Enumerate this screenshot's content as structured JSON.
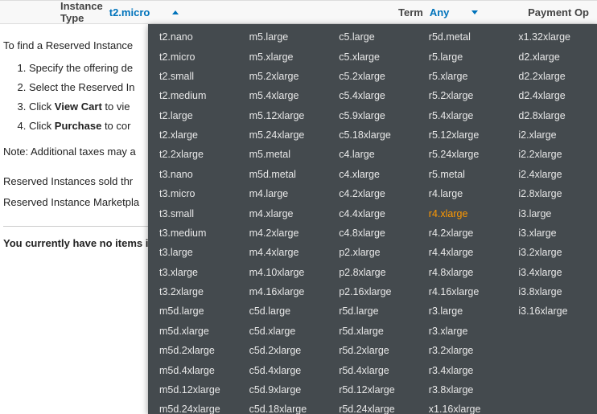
{
  "header": {
    "instance_type_label": "Instance Type",
    "instance_type_value": "t2.micro",
    "term_label": "Term",
    "term_value": "Any",
    "payment_label": "Payment Op"
  },
  "content": {
    "intro": "To find a Reserved Instance",
    "steps": [
      "Specify the offering de",
      "Select the Reserved In",
      "Click View Cart to vie",
      "Click Purchase to cor"
    ],
    "step_bold": {
      "2": "View Cart",
      "3": "Purchase"
    },
    "note": "Note: Additional taxes may a",
    "marketplace1": "Reserved Instances sold thr",
    "marketplace2": "Reserved Instance Marketpla",
    "cart_status": "You currently have no items in y"
  },
  "dropdown": {
    "highlight": "r4.xlarge",
    "columns": [
      [
        "t2.nano",
        "t2.micro",
        "t2.small",
        "t2.medium",
        "t2.large",
        "t2.xlarge",
        "t2.2xlarge",
        "t3.nano",
        "t3.micro",
        "t3.small",
        "t3.medium",
        "t3.large",
        "t3.xlarge",
        "t3.2xlarge",
        "m5d.large",
        "m5d.xlarge",
        "m5d.2xlarge",
        "m5d.4xlarge",
        "m5d.12xlarge",
        "m5d.24xlarge"
      ],
      [
        "m5.large",
        "m5.xlarge",
        "m5.2xlarge",
        "m5.4xlarge",
        "m5.12xlarge",
        "m5.24xlarge",
        "m5.metal",
        "m5d.metal",
        "m4.large",
        "m4.xlarge",
        "m4.2xlarge",
        "m4.4xlarge",
        "m4.10xlarge",
        "m4.16xlarge",
        "c5d.large",
        "c5d.xlarge",
        "c5d.2xlarge",
        "c5d.4xlarge",
        "c5d.9xlarge",
        "c5d.18xlarge"
      ],
      [
        "c5.large",
        "c5.xlarge",
        "c5.2xlarge",
        "c5.4xlarge",
        "c5.9xlarge",
        "c5.18xlarge",
        "c4.large",
        "c4.xlarge",
        "c4.2xlarge",
        "c4.4xlarge",
        "c4.8xlarge",
        "p2.xlarge",
        "p2.8xlarge",
        "p2.16xlarge",
        "r5d.large",
        "r5d.xlarge",
        "r5d.2xlarge",
        "r5d.4xlarge",
        "r5d.12xlarge",
        "r5d.24xlarge"
      ],
      [
        "r5d.metal",
        "r5.large",
        "r5.xlarge",
        "r5.2xlarge",
        "r5.4xlarge",
        "r5.12xlarge",
        "r5.24xlarge",
        "r5.metal",
        "r4.large",
        "r4.xlarge",
        "r4.2xlarge",
        "r4.4xlarge",
        "r4.8xlarge",
        "r4.16xlarge",
        "r3.large",
        "r3.xlarge",
        "r3.2xlarge",
        "r3.4xlarge",
        "r3.8xlarge",
        "x1.16xlarge"
      ],
      [
        "x1.32xlarge",
        "d2.xlarge",
        "d2.2xlarge",
        "d2.4xlarge",
        "d2.8xlarge",
        "i2.xlarge",
        "i2.2xlarge",
        "i2.4xlarge",
        "i2.8xlarge",
        "i3.large",
        "i3.xlarge",
        "i3.2xlarge",
        "i3.4xlarge",
        "i3.8xlarge",
        "i3.16xlarge"
      ]
    ]
  }
}
